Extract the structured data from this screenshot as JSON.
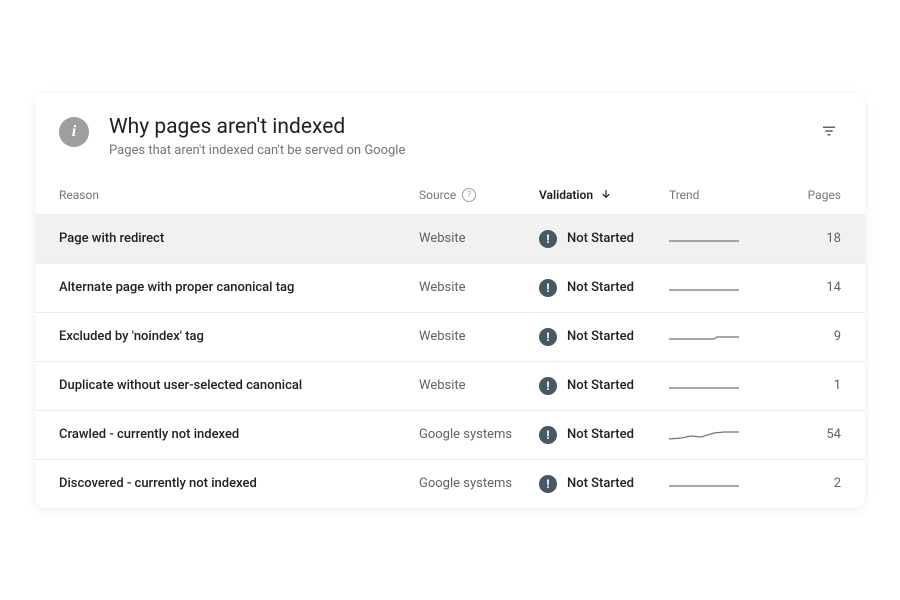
{
  "header": {
    "title": "Why pages aren't indexed",
    "subtitle": "Pages that aren't indexed can't be served on Google"
  },
  "columns": {
    "reason": "Reason",
    "source": "Source",
    "validation": "Validation",
    "trend": "Trend",
    "pages": "Pages"
  },
  "rows": [
    {
      "reason": "Page with redirect",
      "source": "Website",
      "validation": "Not Started",
      "pages": "18",
      "selected": true,
      "spark": "flat"
    },
    {
      "reason": "Alternate page with proper canonical tag",
      "source": "Website",
      "validation": "Not Started",
      "pages": "14",
      "selected": false,
      "spark": "flat"
    },
    {
      "reason": "Excluded by 'noindex' tag",
      "source": "Website",
      "validation": "Not Started",
      "pages": "9",
      "selected": false,
      "spark": "step"
    },
    {
      "reason": "Duplicate without user-selected canonical",
      "source": "Website",
      "validation": "Not Started",
      "pages": "1",
      "selected": false,
      "spark": "flat"
    },
    {
      "reason": "Crawled - currently not indexed",
      "source": "Google systems",
      "validation": "Not Started",
      "pages": "54",
      "selected": false,
      "spark": "wave"
    },
    {
      "reason": "Discovered - currently not indexed",
      "source": "Google systems",
      "validation": "Not Started",
      "pages": "2",
      "selected": false,
      "spark": "flat"
    }
  ]
}
